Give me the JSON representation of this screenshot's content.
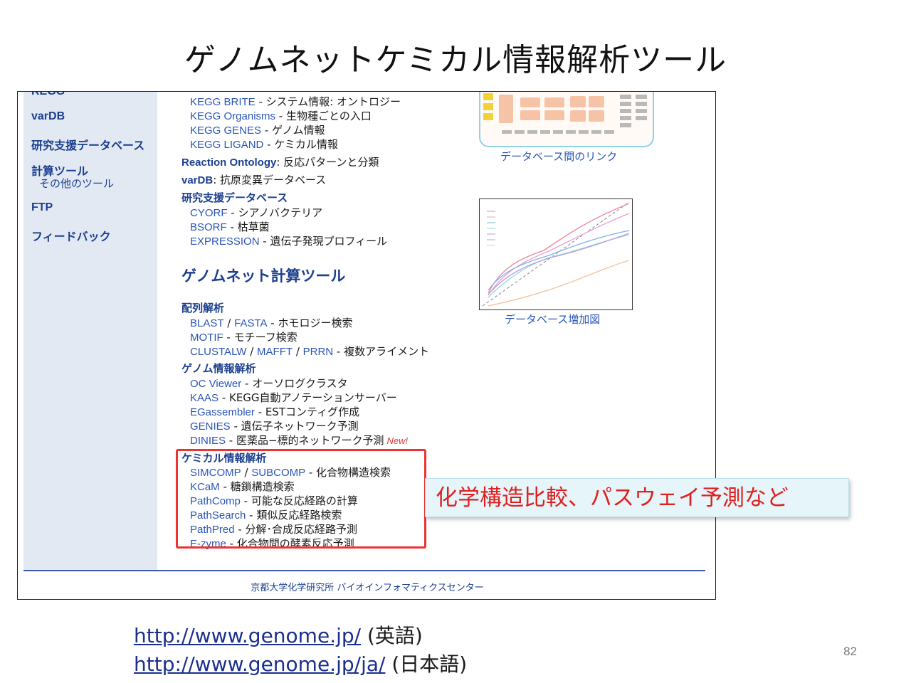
{
  "slide_title": "ゲノムネットケミカル情報解析ツール",
  "sidebar": {
    "items": [
      {
        "label": "KEGG"
      },
      {
        "label": "varDB"
      },
      {
        "label": "研究支援データベース"
      },
      {
        "label": "計算ツール"
      },
      {
        "label": "その他のツール"
      },
      {
        "label": "FTP"
      },
      {
        "label": "フィードバック"
      }
    ]
  },
  "main": {
    "kegg_links": [
      {
        "name": "KEGG BRITE",
        "desc": " - システム情報: オントロジー"
      },
      {
        "name": "KEGG Organisms",
        "desc": " - 生物種ごとの入口"
      },
      {
        "name": "KEGG GENES",
        "desc": " - ゲノム情報"
      },
      {
        "name": "KEGG LIGAND",
        "desc": " - ケミカル情報"
      }
    ],
    "reaction_ontology": {
      "name": "Reaction Ontology",
      "desc": ": 反応パターンと分類"
    },
    "vardb": {
      "name": "varDB",
      "desc": ": 抗原変異データベース"
    },
    "research_db": {
      "heading": "研究支援データベース",
      "items": [
        {
          "name": "CYORF",
          "desc": " - シアノバクテリア"
        },
        {
          "name": "BSORF",
          "desc": " - 枯草菌"
        },
        {
          "name": "EXPRESSION",
          "desc": " - 遺伝子発現プロフィール"
        }
      ]
    },
    "tools_heading": "ゲノムネット計算ツール",
    "sequence": {
      "heading": "配列解析",
      "blast": "BLAST",
      "fasta": "FASTA",
      "blast_desc": " - ホモロジー検索",
      "motif": "MOTIF",
      "motif_desc": " - モチーフ検索",
      "clustalw": "CLUSTALW",
      "mafft": "MAFFT",
      "prrn": "PRRN",
      "clustal_desc": " - 複数アライメント"
    },
    "genome": {
      "heading": "ゲノム情報解析",
      "items": [
        {
          "name": "OC Viewer",
          "desc": " - オーソログクラスタ"
        },
        {
          "name": "KAAS",
          "desc": " - KEGG自動アノテーションサーバー"
        },
        {
          "name": "EGassembler",
          "desc": " - ESTコンティグ作成"
        },
        {
          "name": "GENIES",
          "desc": " - 遺伝子ネットワーク予測"
        },
        {
          "name": "DINIES",
          "desc": " - 医薬品−標的ネットワーク予測"
        }
      ],
      "new_tag": "New!"
    },
    "chem": {
      "heading": "ケミカル情報解析",
      "simcomp": "SIMCOMP",
      "subcomp": "SUBCOMP",
      "simcomp_desc": " - 化合物構造検索",
      "items": [
        {
          "name": "KCaM",
          "desc": " - 糖鎖構造検索"
        },
        {
          "name": "PathComp",
          "desc": " - 可能な反応経路の計算"
        },
        {
          "name": "PathSearch",
          "desc": " - 類似反応経路検索"
        },
        {
          "name": "PathPred",
          "desc": " - 分解･合成反応経路予測"
        },
        {
          "name": "E-zyme",
          "desc": " - 化合物間の酵素反応予測"
        }
      ]
    }
  },
  "figures": {
    "db_link_caption": "データベース間のリンク",
    "db_growth_caption": "データベース増加図"
  },
  "footer": "京都大学化学研究所 バイオインフォマティクスセンター",
  "callout": "化学構造比較、パスウェイ予測など",
  "urls": [
    {
      "url": "http://www.genome.jp/",
      "lang": "(英語)"
    },
    {
      "url": "http://www.genome.jp/ja/",
      "lang": "(日本語)"
    }
  ],
  "page_number": "82",
  "colors": {
    "link": "#2a55b8",
    "heading": "#1b3f8f",
    "highlight": "#e33333",
    "callout_bg": "#e6f5f9"
  }
}
